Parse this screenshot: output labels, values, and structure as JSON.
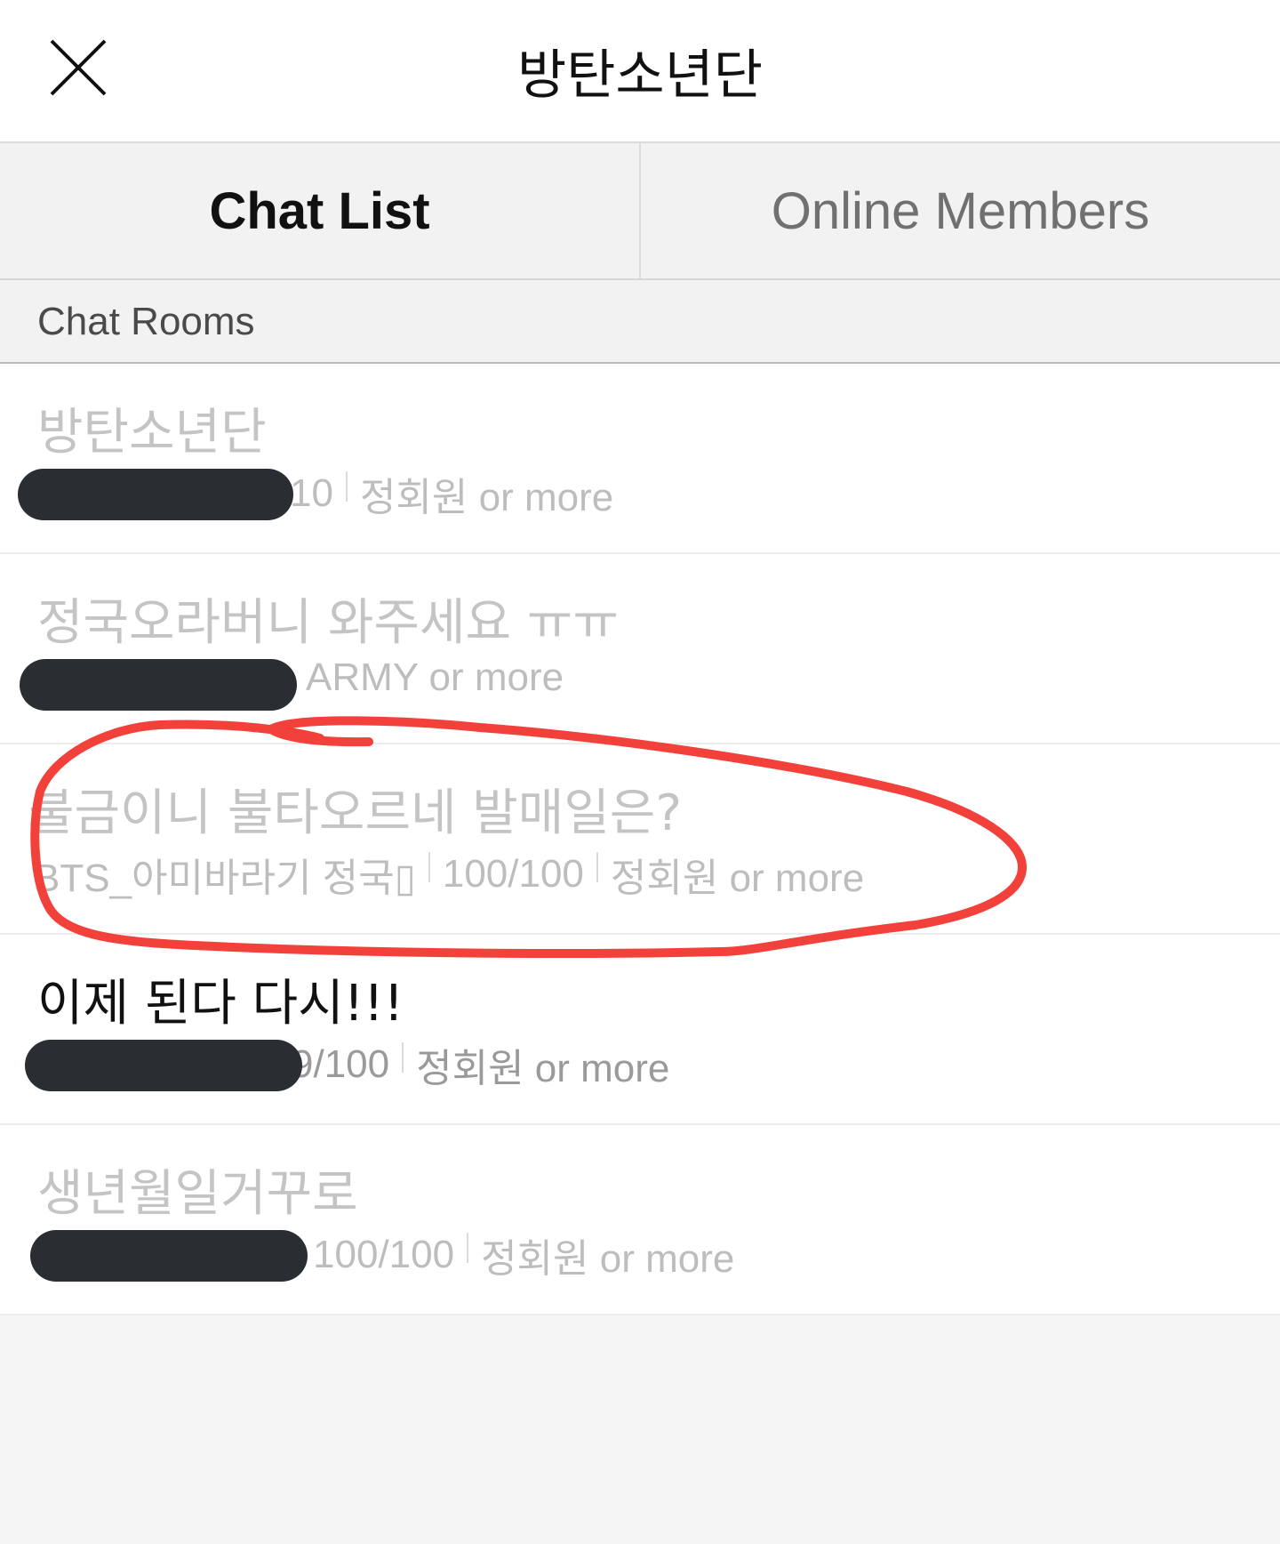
{
  "header": {
    "title": "방탄소년단",
    "close_icon": "close-icon"
  },
  "tabs": [
    {
      "label": "Chat List",
      "active": true
    },
    {
      "label": "Online Members",
      "active": false
    }
  ],
  "section": {
    "label": "Chat Rooms"
  },
  "rooms": [
    {
      "name": "방탄소년단",
      "count": "10",
      "requirement": "정회원 or more"
    },
    {
      "name": "정국오라버니 와주세요 ㅠㅠ",
      "requirement": "ARMY or more"
    },
    {
      "name": "불금이니 불타오르네 발매일은?",
      "owner": "BTS_아미바라기 정국▯",
      "count": "100/100",
      "requirement": "정회원 or more"
    },
    {
      "name": "이제 된다 다시!!!",
      "count": "9/100",
      "requirement": "정회원 or more"
    },
    {
      "name": "생년월일거꾸로",
      "count": "100/100",
      "requirement": "정회원 or more"
    }
  ],
  "colors": {
    "annotation": "#f2413a",
    "redaction": "#2a2e33"
  }
}
